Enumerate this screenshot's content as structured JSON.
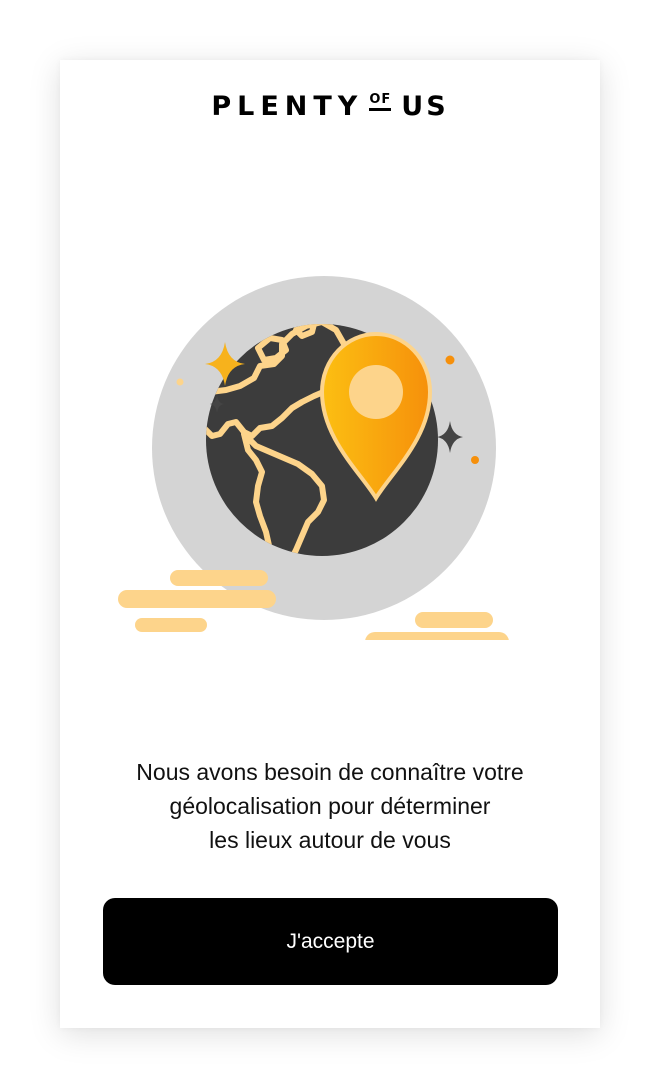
{
  "brand": {
    "word1": "PLENTY",
    "word2": "OF",
    "word3": "US"
  },
  "illustration": {
    "icon": "globe-location-icon",
    "colors": {
      "globe": "#3c3c3c",
      "halo": "#d4d4d4",
      "continents": "#fdd48b",
      "pin_start": "#fcbf12",
      "pin_end": "#f6900b",
      "marker": "#c8302f",
      "sparkle": "#f7b21c"
    }
  },
  "message": {
    "line1": "Nous avons besoin de connaître votre",
    "line2": "géolocalisation pour déterminer",
    "line3": "les lieux autour de vous"
  },
  "accept_button": {
    "label": "J'accepte"
  }
}
